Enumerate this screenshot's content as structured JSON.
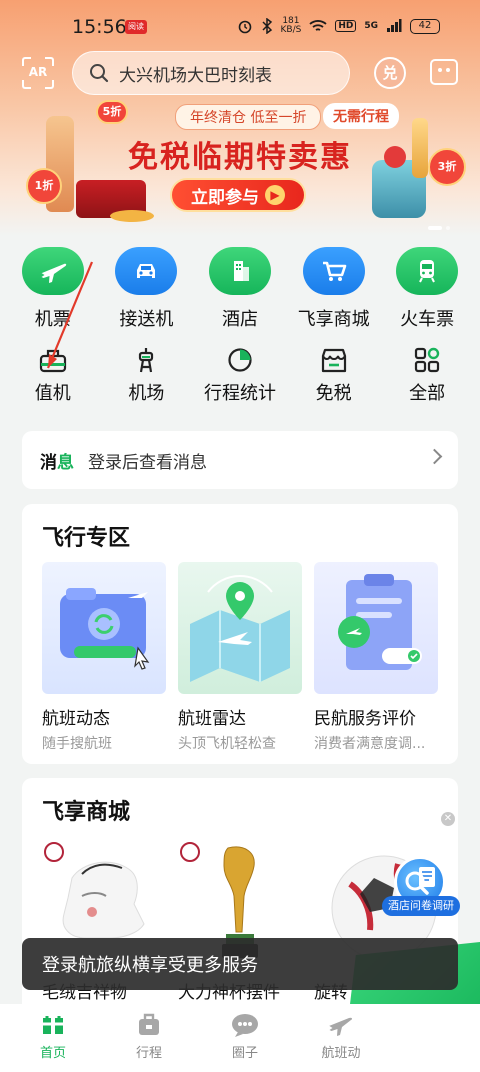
{
  "status_bar": {
    "time": "15:56",
    "app_badge": "阅读",
    "net_speed_value": "181",
    "net_speed_unit": "KB/S",
    "hd": "HD",
    "signal": "5G",
    "battery": "42"
  },
  "header": {
    "scan_label": "AR",
    "search_placeholder": "大兴机场大巴时刻表",
    "exchange_label": "兑"
  },
  "banner": {
    "tag_left": "年终清仓 低至一折",
    "tag_right": "无需行程",
    "title": "免税临期特卖惠",
    "cta": "立即参与",
    "badge_1": "1折",
    "badge_5": "5折",
    "badge_3": "3折"
  },
  "quick_nav": {
    "row1": [
      {
        "label": "机票",
        "icon": "plane-icon"
      },
      {
        "label": "接送机",
        "icon": "car-icon"
      },
      {
        "label": "酒店",
        "icon": "hotel-icon"
      },
      {
        "label": "飞享商城",
        "icon": "cart-icon"
      },
      {
        "label": "火车票",
        "icon": "train-icon"
      }
    ],
    "row2": [
      {
        "label": "值机",
        "icon": "checkin-icon"
      },
      {
        "label": "机场",
        "icon": "airport-icon"
      },
      {
        "label": "行程统计",
        "icon": "pie-chart-icon"
      },
      {
        "label": "免税",
        "icon": "shop-icon"
      },
      {
        "label": "全部",
        "icon": "grid-icon"
      }
    ]
  },
  "message": {
    "tag_a": "消",
    "tag_b": "息",
    "text": "登录后查看消息"
  },
  "flight_zone": {
    "title": "飞行专区",
    "tiles": [
      {
        "name": "航班动态",
        "sub": "随手搜航班"
      },
      {
        "name": "航班雷达",
        "sub": "头顶飞机轻松查"
      },
      {
        "name": "民航服务评价",
        "sub": "消费者满意度调..."
      }
    ]
  },
  "mall": {
    "title": "飞享商城",
    "products": [
      {
        "name": "毛绒吉祥物"
      },
      {
        "name": "大力神杯摆件"
      },
      {
        "name": "旋转"
      }
    ],
    "survey_label": "酒店问卷调研"
  },
  "toast": {
    "text": "登录航旅纵横享受更多服务"
  },
  "bottom_nav": {
    "tabs": [
      {
        "label": "首页",
        "active": true
      },
      {
        "label": "行程",
        "active": false
      },
      {
        "label": "圈子",
        "active": false
      },
      {
        "label": "航班动",
        "active": false
      }
    ]
  },
  "colors": {
    "brand_green": "#19b35b",
    "accent_blue": "#1a7dea",
    "promo_red": "#d8231f"
  }
}
